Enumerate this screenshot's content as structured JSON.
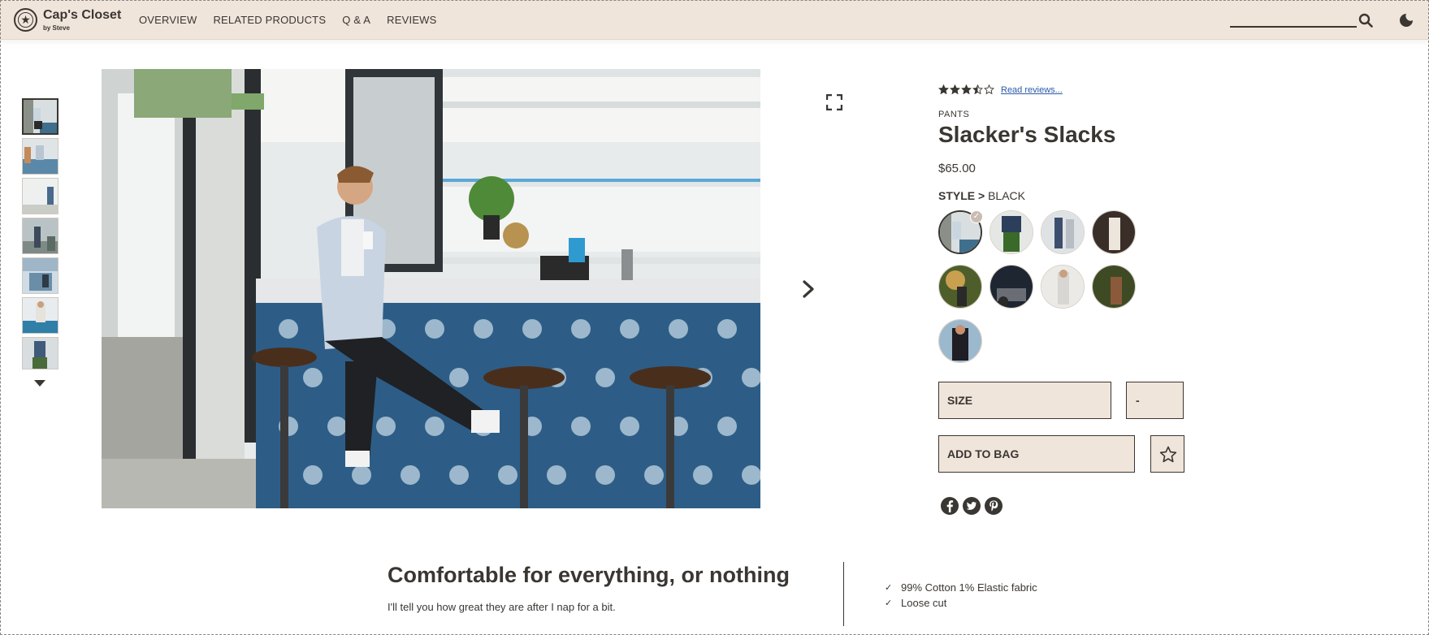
{
  "header": {
    "brand": "Cap's Closet",
    "brand_sub": "by Steve",
    "nav": [
      "OVERVIEW",
      "RELATED PRODUCTS",
      "Q & A",
      "REVIEWS"
    ],
    "icons": [
      "logo-icon",
      "search-icon",
      "moon-icon"
    ]
  },
  "gallery": {
    "thumbnail_count": 7,
    "active_thumbnail": 0,
    "icons": [
      "chevron-down-icon",
      "expand-icon",
      "chevron-right-icon"
    ]
  },
  "product": {
    "rating": 3.5,
    "rating_max": 5,
    "read_reviews": "Read reviews...",
    "category": "PANTS",
    "name": "Slacker's Slacks",
    "price": "$65.00",
    "style_label": "STYLE >",
    "style_value": "BLACK",
    "style_count": 9,
    "selected_style": 0,
    "size_label": "SIZE",
    "qty_label": "-",
    "add_to_bag": "ADD TO BAG",
    "social": [
      "facebook-icon",
      "twitter-icon",
      "pinterest-icon"
    ]
  },
  "description": {
    "title": "Comfortable for everything, or nothing",
    "body": "I'll tell you how great they are after I nap for a bit.",
    "features": [
      "99% Cotton 1% Elastic fabric",
      "Loose cut"
    ]
  },
  "colors": {
    "header_bg": "#f0e5db",
    "text": "#3a3632",
    "link": "#2b5aa8"
  }
}
